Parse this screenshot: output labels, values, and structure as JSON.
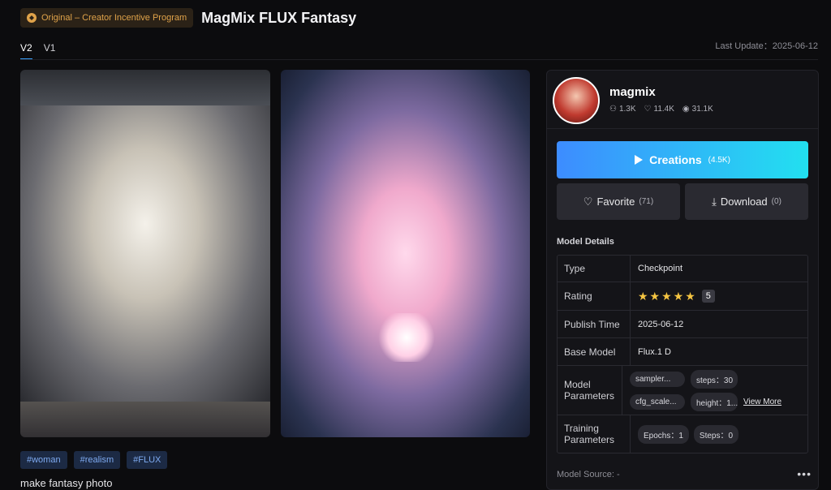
{
  "header": {
    "badge_label": "Original – Creator Incentive Program",
    "title": "MagMix FLUX Fantasy"
  },
  "tabs": [
    {
      "label": "V2",
      "active": true
    },
    {
      "label": "V1",
      "active": false
    }
  ],
  "last_update": "Last Update：2025-06-12",
  "tags": [
    "#woman",
    "#realism",
    "#FLUX"
  ],
  "description": "make fantasy photo",
  "creator": {
    "username": "magmix",
    "followers": "1.3K",
    "likes": "11.4K",
    "views": "31.1K"
  },
  "actions": {
    "creations_label": "Creations",
    "creations_count": "(4.5K)",
    "favorite_label": "Favorite",
    "favorite_count": "(71)",
    "download_label": "Download",
    "download_count": "(0)"
  },
  "model_details": {
    "section_title": "Model Details",
    "type_label": "Type",
    "type_value": "Checkpoint",
    "rating_label": "Rating",
    "rating_stars": "★★★★★",
    "rating_value": "5",
    "publish_label": "Publish Time",
    "publish_value": "2025-06-12",
    "base_model_label": "Base Model",
    "base_model_value": "Flux.1 D",
    "params_label": "Model Parameters",
    "params": [
      "sampler...",
      "steps：30",
      "cfg_scale...",
      "height：1..."
    ],
    "view_more": "View More",
    "training_label": "Training Parameters",
    "training": [
      "Epochs：1",
      "Steps：0"
    ]
  },
  "model_source": "Model Source: -",
  "colors": {
    "accent_start": "#3d8cff",
    "accent_end": "#22e0f0",
    "tag_bg": "#1c2a44",
    "tag_text": "#7eaaf0",
    "badge_text": "#e0a34a",
    "star": "#f5c542"
  }
}
